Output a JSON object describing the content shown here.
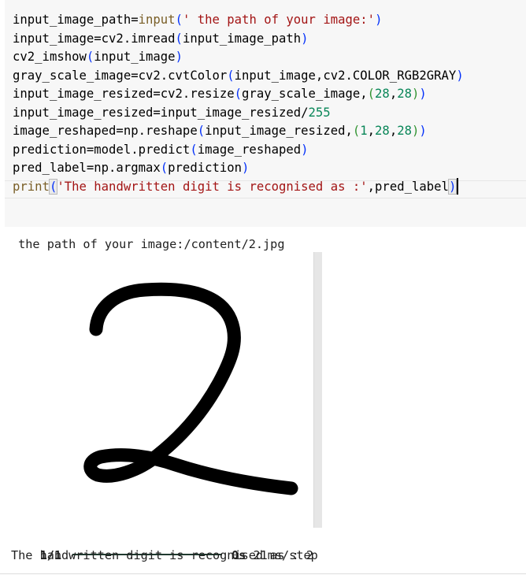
{
  "code_cell": {
    "lines": [
      {
        "parts": [
          {
            "t": "input_image_path=",
            "c": ""
          },
          {
            "t": "input",
            "c": "fn"
          },
          {
            "t": "(",
            "c": "br1"
          },
          {
            "t": "' the path of your image:'",
            "c": "str"
          },
          {
            "t": ")",
            "c": "br1"
          }
        ]
      },
      {
        "parts": [
          {
            "t": "input_image=cv2.imread",
            "c": ""
          },
          {
            "t": "(",
            "c": "br1"
          },
          {
            "t": "input_image_path",
            "c": ""
          },
          {
            "t": ")",
            "c": "br1"
          }
        ]
      },
      {
        "parts": [
          {
            "t": "cv2_imshow",
            "c": ""
          },
          {
            "t": "(",
            "c": "br1"
          },
          {
            "t": "input_image",
            "c": ""
          },
          {
            "t": ")",
            "c": "br1"
          }
        ]
      },
      {
        "parts": [
          {
            "t": "gray_scale_image=cv2.cvtColor",
            "c": ""
          },
          {
            "t": "(",
            "c": "br1"
          },
          {
            "t": "input_image,cv2.COLOR_RGB2GRAY",
            "c": ""
          },
          {
            "t": ")",
            "c": "br1"
          }
        ]
      },
      {
        "parts": [
          {
            "t": "input_image_resized=cv2.resize",
            "c": ""
          },
          {
            "t": "(",
            "c": "br1"
          },
          {
            "t": "gray_scale_image,",
            "c": ""
          },
          {
            "t": "(",
            "c": "br2"
          },
          {
            "t": "28",
            "c": "num"
          },
          {
            "t": ",",
            "c": ""
          },
          {
            "t": "28",
            "c": "num"
          },
          {
            "t": ")",
            "c": "br2"
          },
          {
            "t": ")",
            "c": "br1"
          }
        ]
      },
      {
        "parts": [
          {
            "t": "input_image_resized=input_image_resized/",
            "c": ""
          },
          {
            "t": "255",
            "c": "num"
          }
        ]
      },
      {
        "parts": [
          {
            "t": "image_reshaped=np.reshape",
            "c": ""
          },
          {
            "t": "(",
            "c": "br1"
          },
          {
            "t": "input_image_resized,",
            "c": ""
          },
          {
            "t": "(",
            "c": "br2"
          },
          {
            "t": "1",
            "c": "num"
          },
          {
            "t": ",",
            "c": ""
          },
          {
            "t": "28",
            "c": "num"
          },
          {
            "t": ",",
            "c": ""
          },
          {
            "t": "28",
            "c": "num"
          },
          {
            "t": ")",
            "c": "br2"
          },
          {
            "t": ")",
            "c": "br1"
          }
        ]
      },
      {
        "parts": [
          {
            "t": "prediction=model.predict",
            "c": ""
          },
          {
            "t": "(",
            "c": "br1"
          },
          {
            "t": "image_reshaped",
            "c": ""
          },
          {
            "t": ")",
            "c": "br1"
          }
        ]
      },
      {
        "parts": [
          {
            "t": "pred_label=np.argmax",
            "c": ""
          },
          {
            "t": "(",
            "c": "br1"
          },
          {
            "t": "prediction",
            "c": ""
          },
          {
            "t": ")",
            "c": "br1"
          }
        ]
      },
      {
        "parts": [
          {
            "t": "print",
            "c": "kw"
          },
          {
            "t": "(",
            "c": "br1 match-paren"
          },
          {
            "t": "'The handwritten digit is recognised as :'",
            "c": "str"
          },
          {
            "t": ",pred_label",
            "c": ""
          },
          {
            "t": ")",
            "c": "br1 match-paren"
          }
        ]
      }
    ]
  },
  "output": {
    "prompt_line": " the path of your image:/content/2.jpg",
    "progress": {
      "steps": "1/1",
      "fraction": 1.0,
      "time": "0s",
      "per_step": " 21ms/step"
    },
    "result_line": "The handwritten digit is recognised as : 2"
  },
  "colors": {
    "cell_background": "#f7f7f7",
    "string": "#a31515",
    "number": "#098658",
    "function": "#795e26",
    "bracket_level_1": "#0431fa",
    "bracket_level_2": "#319331",
    "progress_bar": "#1f3a2f"
  },
  "image": {
    "content": "handwritten-digit-2",
    "ink_color": "#000000",
    "background": "#ffffff"
  }
}
